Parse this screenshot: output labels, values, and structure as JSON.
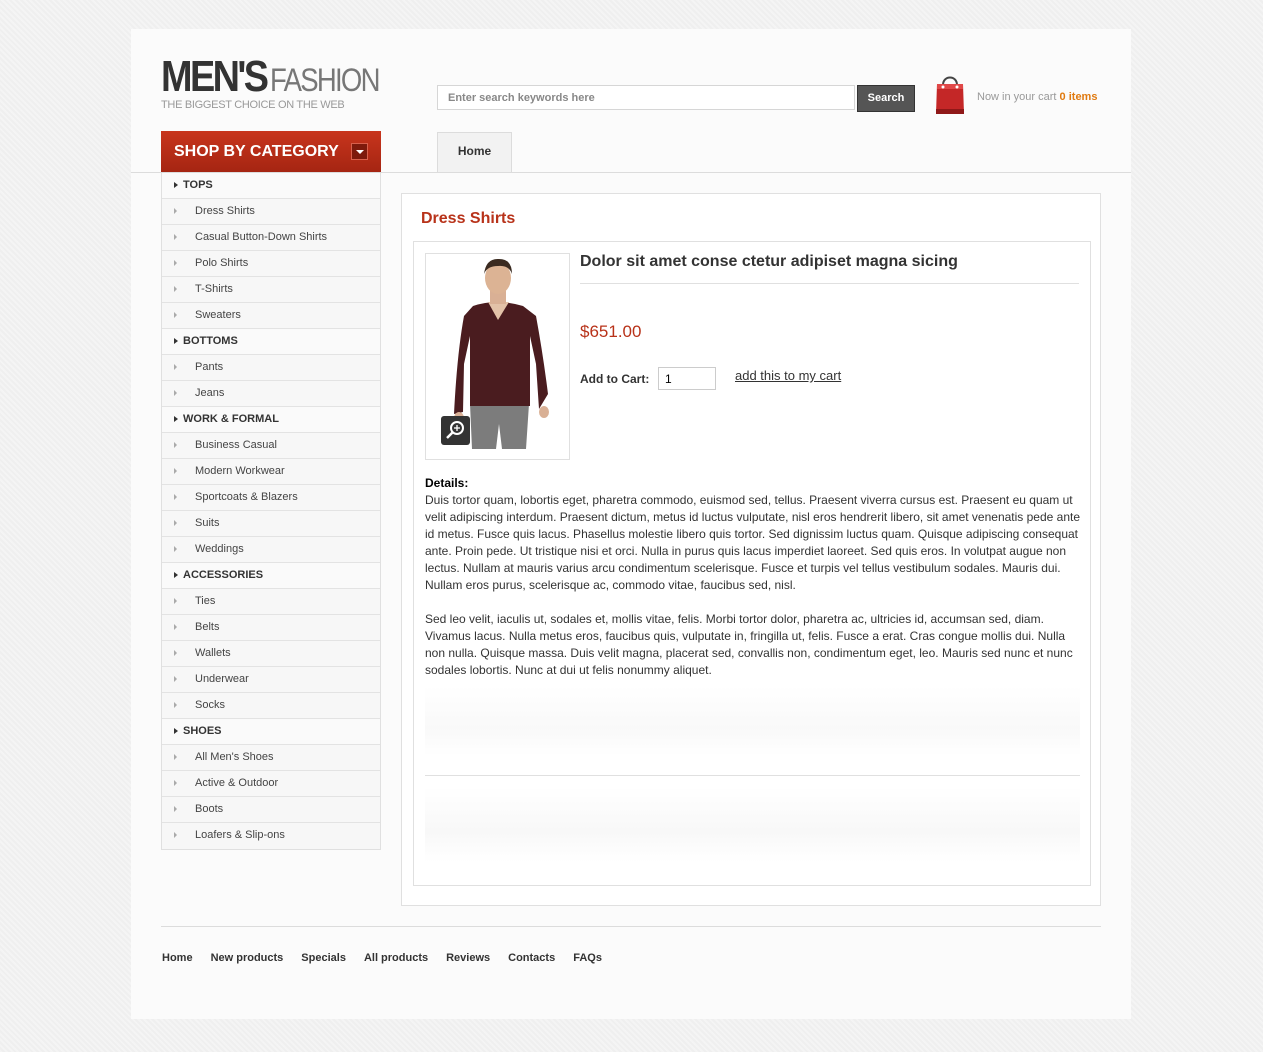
{
  "brand": {
    "name_bold": "MEN'S",
    "name_light": "FASHION",
    "tagline": "THE BIGGEST CHOICE ON THE WEB"
  },
  "search": {
    "placeholder": "Enter search keywords here",
    "button_label": "Search"
  },
  "cart": {
    "label": "Now in your cart",
    "count": "0 items"
  },
  "category_header": "SHOP BY CATEGORY",
  "nav": {
    "home_tab": "Home"
  },
  "sidebar": {
    "items": [
      {
        "label": "TOPS",
        "level": "top"
      },
      {
        "label": "Dress Shirts",
        "level": "sub"
      },
      {
        "label": "Casual Button-Down Shirts",
        "level": "sub"
      },
      {
        "label": "Polo Shirts",
        "level": "sub"
      },
      {
        "label": "T-Shirts",
        "level": "sub"
      },
      {
        "label": "Sweaters",
        "level": "sub"
      },
      {
        "label": "BOTTOMS",
        "level": "top"
      },
      {
        "label": "Pants",
        "level": "sub"
      },
      {
        "label": "Jeans",
        "level": "sub"
      },
      {
        "label": "WORK & FORMAL",
        "level": "top"
      },
      {
        "label": "Business Casual",
        "level": "sub"
      },
      {
        "label": "Modern Workwear",
        "level": "sub"
      },
      {
        "label": "Sportcoats & Blazers",
        "level": "sub"
      },
      {
        "label": "Suits",
        "level": "sub"
      },
      {
        "label": "Weddings",
        "level": "sub"
      },
      {
        "label": "ACCESSORIES",
        "level": "top"
      },
      {
        "label": "Ties",
        "level": "sub"
      },
      {
        "label": "Belts",
        "level": "sub"
      },
      {
        "label": "Wallets",
        "level": "sub"
      },
      {
        "label": "Underwear",
        "level": "sub"
      },
      {
        "label": "Socks",
        "level": "sub"
      },
      {
        "label": "SHOES",
        "level": "top"
      },
      {
        "label": "All Men's Shoes",
        "level": "sub"
      },
      {
        "label": "Active & Outdoor",
        "level": "sub"
      },
      {
        "label": "Boots",
        "level": "sub"
      },
      {
        "label": "Loafers & Slip-ons",
        "level": "sub"
      }
    ]
  },
  "content": {
    "title": "Dress Shirts",
    "product": {
      "name": "Dolor sit amet conse ctetur adipiset magna sicing",
      "price": "$651.00",
      "add_to_cart_label": "Add to Cart:",
      "quantity": "1",
      "add_link": "add this to my cart",
      "details_label": "Details:",
      "details_p1": "Duis tortor quam, lobortis eget, pharetra commodo, euismod sed, tellus. Praesent viverra cursus est. Praesent eu quam ut velit adipiscing interdum. Praesent dictum, metus id luctus vulputate, nisl eros hendrerit libero, sit amet venenatis pede ante id metus. Fusce quis lacus. Phasellus molestie libero quis tortor. Sed dignissim luctus quam. Quisque adipiscing consequat ante. Proin pede. Ut tristique nisi et orci. Nulla in purus quis lacus imperdiet laoreet. Sed quis eros. In volutpat augue non lectus. Nullam at mauris varius arcu condimentum scelerisque. Fusce et turpis vel tellus vestibulum sodales. Mauris dui. Nullam eros purus, scelerisque ac, commodo vitae, faucibus sed, nisl.",
      "details_p2": "Sed leo velit, iaculis ut, sodales et, mollis vitae, felis. Morbi tortor dolor, pharetra ac, ultricies id, accumsan sed, diam. Vivamus lacus. Nulla metus eros, faucibus quis, vulputate in, fringilla ut, felis. Fusce a erat. Cras congue mollis dui. Nulla non nulla. Quisque massa. Duis velit magna, placerat sed, convallis non, condimentum eget, leo. Mauris sed nunc et nunc sodales lobortis. Nunc at dui ut felis nonummy aliquet."
    }
  },
  "footer": {
    "links": [
      "Home",
      "New products",
      "Specials",
      "All products",
      "Reviews",
      "Contacts",
      "FAQs"
    ]
  },
  "colors": {
    "accent_red": "#b83219",
    "cart_orange": "#e07a10",
    "category_header": "#c8351d"
  },
  "icons": [
    "shopping-bag-icon",
    "zoom-icon",
    "dropdown-arrow-icon"
  ]
}
